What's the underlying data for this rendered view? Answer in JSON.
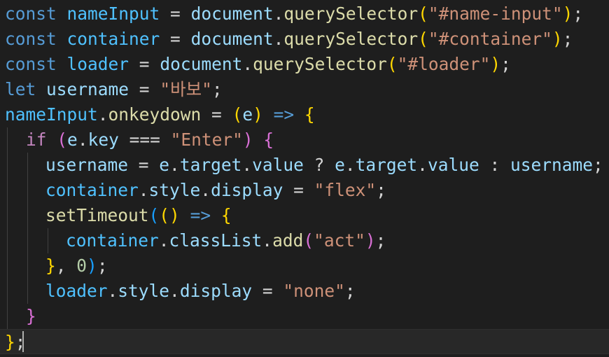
{
  "editor": {
    "language": "javascript",
    "theme_colors": {
      "background": "#1e1e1e",
      "keyword": "#569cd6",
      "control": "#c586c0",
      "variable": "#9cdcfe",
      "function": "#dcdcaa",
      "string": "#ce9178",
      "number": "#b5cea8",
      "bracket_1": "#ffd700",
      "bracket_2": "#da70d6",
      "bracket_3": "#179fff"
    },
    "lines": [
      {
        "tokens": [
          {
            "t": "const",
            "c": "kw"
          },
          {
            "t": " ",
            "c": "op"
          },
          {
            "t": "nameInput",
            "c": "cst"
          },
          {
            "t": " = ",
            "c": "op"
          },
          {
            "t": "document",
            "c": "var"
          },
          {
            "t": ".",
            "c": "pn"
          },
          {
            "t": "querySelector",
            "c": "fn"
          },
          {
            "t": "(",
            "c": "b1"
          },
          {
            "t": "\"#name-input\"",
            "c": "str"
          },
          {
            "t": ")",
            "c": "b1"
          },
          {
            "t": ";",
            "c": "pn"
          }
        ]
      },
      {
        "tokens": [
          {
            "t": "const",
            "c": "kw"
          },
          {
            "t": " ",
            "c": "op"
          },
          {
            "t": "container",
            "c": "cst"
          },
          {
            "t": " = ",
            "c": "op"
          },
          {
            "t": "document",
            "c": "var"
          },
          {
            "t": ".",
            "c": "pn"
          },
          {
            "t": "querySelector",
            "c": "fn"
          },
          {
            "t": "(",
            "c": "b1"
          },
          {
            "t": "\"#container\"",
            "c": "str"
          },
          {
            "t": ")",
            "c": "b1"
          },
          {
            "t": ";",
            "c": "pn"
          }
        ]
      },
      {
        "tokens": [
          {
            "t": "const",
            "c": "kw"
          },
          {
            "t": " ",
            "c": "op"
          },
          {
            "t": "loader",
            "c": "cst"
          },
          {
            "t": " = ",
            "c": "op"
          },
          {
            "t": "document",
            "c": "var"
          },
          {
            "t": ".",
            "c": "pn"
          },
          {
            "t": "querySelector",
            "c": "fn"
          },
          {
            "t": "(",
            "c": "b1"
          },
          {
            "t": "\"#loader\"",
            "c": "str"
          },
          {
            "t": ")",
            "c": "b1"
          },
          {
            "t": ";",
            "c": "pn"
          }
        ]
      },
      {
        "tokens": [
          {
            "t": "let",
            "c": "kw"
          },
          {
            "t": " ",
            "c": "op"
          },
          {
            "t": "username",
            "c": "var"
          },
          {
            "t": " = ",
            "c": "op"
          },
          {
            "t": "\"바보\"",
            "c": "str"
          },
          {
            "t": ";",
            "c": "pn"
          }
        ]
      },
      {
        "tokens": [
          {
            "t": "nameInput",
            "c": "cst"
          },
          {
            "t": ".",
            "c": "pn"
          },
          {
            "t": "onkeydown",
            "c": "fn"
          },
          {
            "t": " = ",
            "c": "op"
          },
          {
            "t": "(",
            "c": "b1"
          },
          {
            "t": "e",
            "c": "var"
          },
          {
            "t": ")",
            "c": "b1"
          },
          {
            "t": " ",
            "c": "op"
          },
          {
            "t": "=>",
            "c": "kw"
          },
          {
            "t": " ",
            "c": "op"
          },
          {
            "t": "{",
            "c": "b1"
          }
        ]
      },
      {
        "tokens": [
          {
            "t": "if",
            "c": "ctl"
          },
          {
            "t": " ",
            "c": "op"
          },
          {
            "t": "(",
            "c": "b2"
          },
          {
            "t": "e",
            "c": "var"
          },
          {
            "t": ".",
            "c": "pn"
          },
          {
            "t": "key",
            "c": "var"
          },
          {
            "t": " === ",
            "c": "op"
          },
          {
            "t": "\"Enter\"",
            "c": "str"
          },
          {
            "t": ")",
            "c": "b2"
          },
          {
            "t": " ",
            "c": "op"
          },
          {
            "t": "{",
            "c": "b2"
          }
        ]
      },
      {
        "tokens": [
          {
            "t": "username",
            "c": "var"
          },
          {
            "t": " = ",
            "c": "op"
          },
          {
            "t": "e",
            "c": "var"
          },
          {
            "t": ".",
            "c": "pn"
          },
          {
            "t": "target",
            "c": "var"
          },
          {
            "t": ".",
            "c": "pn"
          },
          {
            "t": "value",
            "c": "var"
          },
          {
            "t": " ? ",
            "c": "op"
          },
          {
            "t": "e",
            "c": "var"
          },
          {
            "t": ".",
            "c": "pn"
          },
          {
            "t": "target",
            "c": "var"
          },
          {
            "t": ".",
            "c": "pn"
          },
          {
            "t": "value",
            "c": "var"
          },
          {
            "t": " : ",
            "c": "op"
          },
          {
            "t": "username",
            "c": "var"
          },
          {
            "t": ";",
            "c": "pn"
          }
        ]
      },
      {
        "tokens": [
          {
            "t": "container",
            "c": "cst"
          },
          {
            "t": ".",
            "c": "pn"
          },
          {
            "t": "style",
            "c": "var"
          },
          {
            "t": ".",
            "c": "pn"
          },
          {
            "t": "display",
            "c": "var"
          },
          {
            "t": " = ",
            "c": "op"
          },
          {
            "t": "\"flex\"",
            "c": "str"
          },
          {
            "t": ";",
            "c": "pn"
          }
        ]
      },
      {
        "tokens": [
          {
            "t": "setTimeout",
            "c": "fn"
          },
          {
            "t": "(",
            "c": "b3"
          },
          {
            "t": "(",
            "c": "b1"
          },
          {
            "t": ")",
            "c": "b1"
          },
          {
            "t": " ",
            "c": "op"
          },
          {
            "t": "=>",
            "c": "kw"
          },
          {
            "t": " ",
            "c": "op"
          },
          {
            "t": "{",
            "c": "b1"
          }
        ]
      },
      {
        "tokens": [
          {
            "t": "container",
            "c": "cst"
          },
          {
            "t": ".",
            "c": "pn"
          },
          {
            "t": "classList",
            "c": "var"
          },
          {
            "t": ".",
            "c": "pn"
          },
          {
            "t": "add",
            "c": "fn"
          },
          {
            "t": "(",
            "c": "b2"
          },
          {
            "t": "\"act\"",
            "c": "str"
          },
          {
            "t": ")",
            "c": "b2"
          },
          {
            "t": ";",
            "c": "pn"
          }
        ]
      },
      {
        "tokens": [
          {
            "t": "}",
            "c": "b1"
          },
          {
            "t": ", ",
            "c": "pn"
          },
          {
            "t": "0",
            "c": "num"
          },
          {
            "t": ")",
            "c": "b3"
          },
          {
            "t": ";",
            "c": "pn"
          }
        ]
      },
      {
        "tokens": [
          {
            "t": "loader",
            "c": "cst"
          },
          {
            "t": ".",
            "c": "pn"
          },
          {
            "t": "style",
            "c": "var"
          },
          {
            "t": ".",
            "c": "pn"
          },
          {
            "t": "display",
            "c": "var"
          },
          {
            "t": " = ",
            "c": "op"
          },
          {
            "t": "\"none\"",
            "c": "str"
          },
          {
            "t": ";",
            "c": "pn"
          }
        ]
      },
      {
        "tokens": [
          {
            "t": "}",
            "c": "b2"
          }
        ]
      },
      {
        "tokens": [
          {
            "t": "}",
            "c": "b1"
          },
          {
            "t": ";",
            "c": "pn"
          }
        ]
      }
    ]
  }
}
